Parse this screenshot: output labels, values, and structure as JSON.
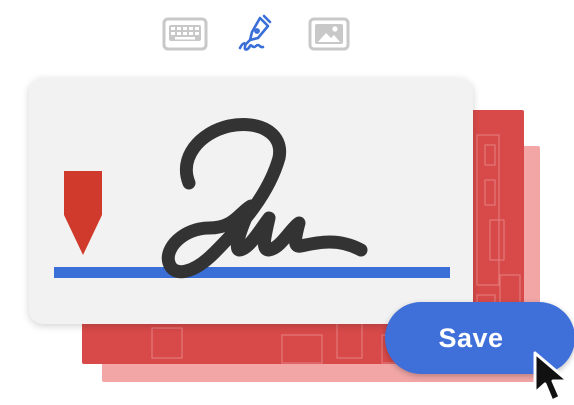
{
  "mode_toolbar": {
    "modes": [
      {
        "icon": "keyboard-icon",
        "state": "inactive"
      },
      {
        "icon": "pen-icon",
        "state": "active"
      },
      {
        "icon": "image-icon",
        "state": "inactive"
      }
    ],
    "active_color": "#3a6fd8",
    "inactive_color": "#9a9a9a"
  },
  "signature_card": {
    "marker_icon": "sign-here-arrow-icon",
    "marker_color": "#d03a2c",
    "baseline_color": "#3a6fd8",
    "ink_color": "#333333"
  },
  "documents": {
    "front_color": "#d84a4a",
    "back_color": "#f2a6a6"
  },
  "actions": {
    "save_label": "Save",
    "save_color": "#3f6fd9"
  },
  "cursor": {
    "icon": "mouse-pointer-icon"
  }
}
